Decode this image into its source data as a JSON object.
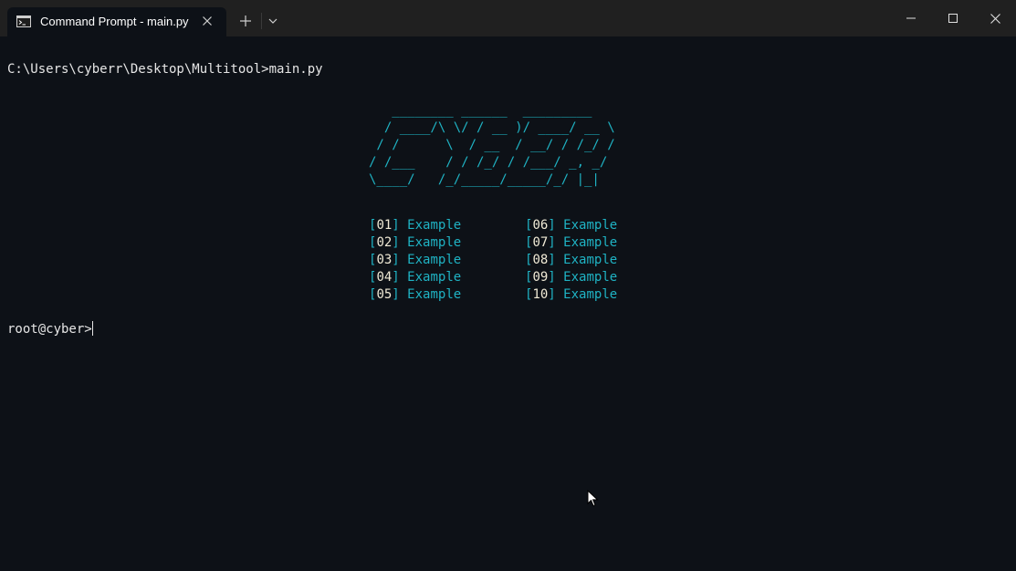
{
  "window": {
    "tab_title": "Command Prompt - main.py",
    "icons": {
      "tab": "command-prompt-icon",
      "tab_close": "close-icon",
      "new_tab": "plus-icon",
      "dropdown": "chevron-down-icon",
      "minimize": "minimize-icon",
      "maximize": "maximize-icon",
      "close": "close-icon"
    }
  },
  "terminal": {
    "command_line": "C:\\Users\\cyberr\\Desktop\\Multitool>main.py",
    "ascii_art": "   ________ ______  _________\n  / ____/\\ \\/ / __ )/ ____/ __ \\\n / /      \\  / __  / __/ / /_/ /\n/ /___    / / /_/ / /___/ _, _/\n\\____/   /_/_____/_____/_/ |_|",
    "menu": [
      {
        "num": "01",
        "label": "Example"
      },
      {
        "num": "02",
        "label": "Example"
      },
      {
        "num": "03",
        "label": "Example"
      },
      {
        "num": "04",
        "label": "Example"
      },
      {
        "num": "05",
        "label": "Example"
      },
      {
        "num": "06",
        "label": "Example"
      },
      {
        "num": "07",
        "label": "Example"
      },
      {
        "num": "08",
        "label": "Example"
      },
      {
        "num": "09",
        "label": "Example"
      },
      {
        "num": "10",
        "label": "Example"
      }
    ],
    "prompt": "root@cyber>"
  },
  "colors": {
    "accent": "#1fb3c4",
    "number": "#f0ead6",
    "background": "#0d1117",
    "titlebar": "#202020"
  }
}
